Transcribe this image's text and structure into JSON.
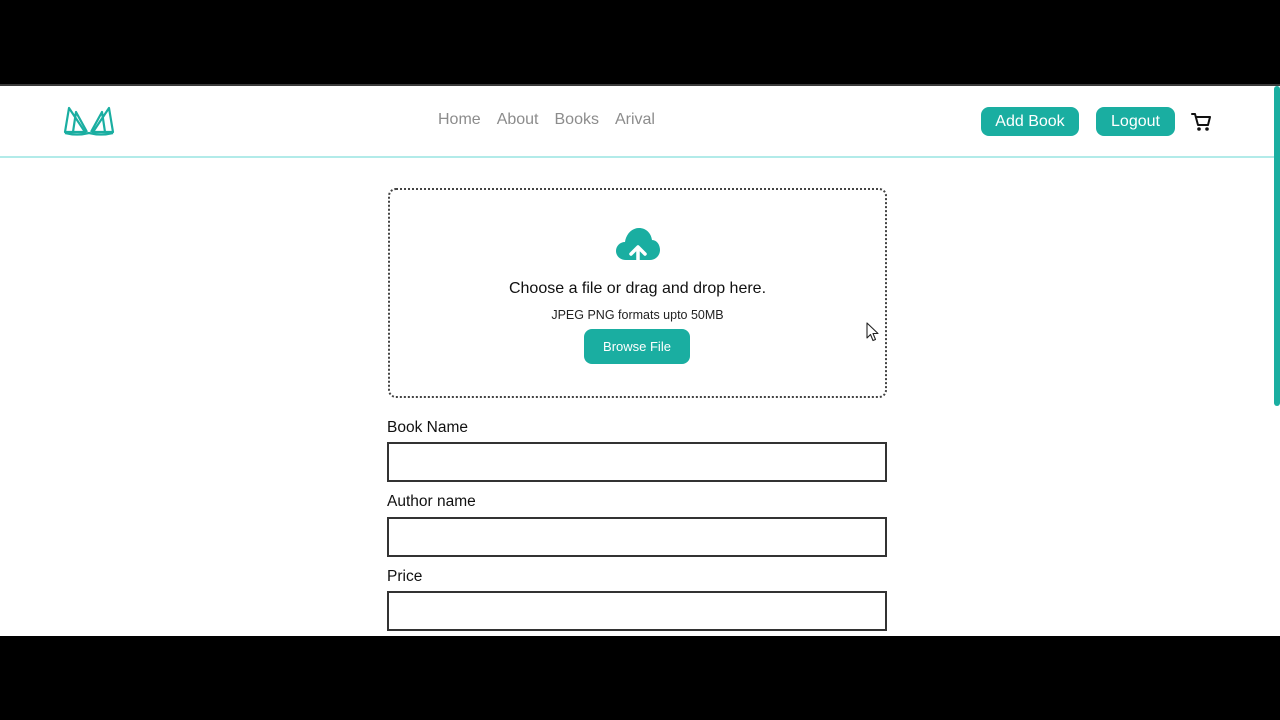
{
  "nav": {
    "links": [
      "Home",
      "About",
      "Books",
      "Arival"
    ],
    "add_book_label": "Add Book",
    "logout_label": "Logout"
  },
  "upload": {
    "title": "Choose a file or drag and drop here.",
    "subtitle": "JPEG PNG formats upto 50MB",
    "browse_label": "Browse File"
  },
  "form": {
    "book_name_label": "Book Name",
    "book_name_value": "",
    "author_label": "Author name",
    "author_value": "",
    "price_label": "Price",
    "price_value": ""
  },
  "icons": {
    "logo": "open-book-icon",
    "cart": "cart-icon",
    "upload": "cloud-upload-icon",
    "cursor": "mouse-pointer-icon"
  },
  "colors": {
    "accent": "#1aaea1",
    "nav_text": "#8c8c8c",
    "nav_border": "#b2ebe9"
  }
}
